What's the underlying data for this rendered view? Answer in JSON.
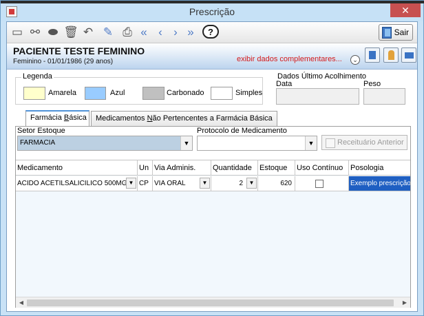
{
  "window": {
    "title": "Prescrição",
    "close_symbol": "✕"
  },
  "toolbar": {
    "icons": [
      "new-icon",
      "binoculars-icon",
      "eraser-icon",
      "trash-icon",
      "undo-icon",
      "edit-icon",
      "print-icon",
      "first-record-icon",
      "previous-record-icon",
      "next-record-icon",
      "last-record-icon",
      "help-icon"
    ],
    "help_symbol": "?",
    "sair_label": "Sair"
  },
  "patient": {
    "name": "PACIENTE TESTE FEMININO",
    "info": "Feminino - 01/01/1986 (29 anos)",
    "extra_link": "exibir dados complementares...",
    "expand_symbol": "⌄"
  },
  "legenda": {
    "title": "Legenda",
    "items": [
      {
        "label": "Amarela",
        "color": "#ffffcc"
      },
      {
        "label": "Azul",
        "color": "#99ccff"
      },
      {
        "label": "Carbonado",
        "color": "#c0c0c0"
      },
      {
        "label": "Simples",
        "color": "#ffffff"
      }
    ]
  },
  "acolhimento": {
    "title": "Dados Último Acolhimento",
    "data_label": "Data",
    "peso_label": "Peso",
    "data_value": "",
    "peso_value": ""
  },
  "tabs": [
    {
      "label_pre": "Farmácia ",
      "label_ul": "B",
      "label_post": "ásica",
      "active": true
    },
    {
      "label_pre": "Medicamentos ",
      "label_ul": "N",
      "label_post": "ão Pertencentes a Farmácia Básica",
      "active": false
    }
  ],
  "form": {
    "setor_label": "Setor Estoque",
    "setor_value": "FARMACIA",
    "protocolo_label": "Protocolo de Medicamento",
    "protocolo_value": "",
    "receituario_label": "Receituário Anterior"
  },
  "grid": {
    "columns": [
      "Medicamento",
      "Un",
      "Via Adminis.",
      "Quantidade",
      "Estoque",
      "Uso Contínuo",
      "Posologia"
    ],
    "rows": [
      {
        "medicamento": "ACIDO ACETILSALICILICO 500MG",
        "un": "CP",
        "via": "VIA ORAL",
        "quantidade": "2",
        "estoque": "620",
        "uso_continuo": false,
        "posologia": "Exemplo prescrição"
      }
    ],
    "drop_symbol": "▼",
    "scroll_left": "◀",
    "scroll_right": "▶"
  }
}
